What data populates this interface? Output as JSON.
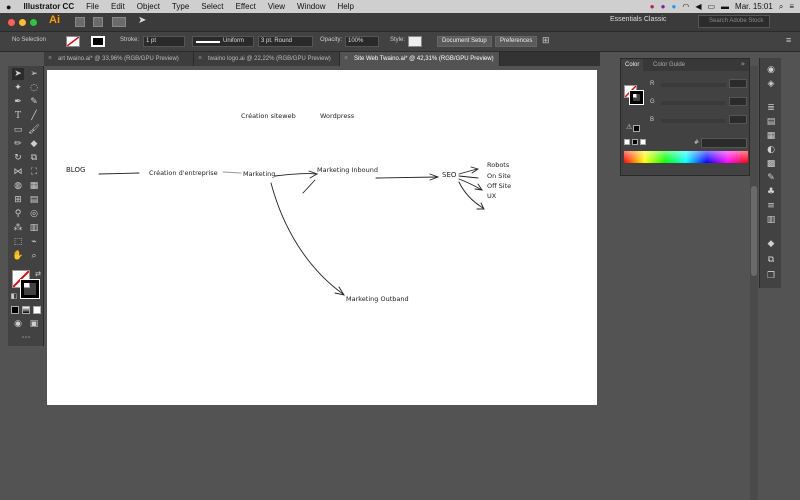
{
  "menubar": {
    "apple": "",
    "app": "Illustrator CC",
    "items": [
      "File",
      "Edit",
      "Object",
      "Type",
      "Select",
      "Effect",
      "View",
      "Window",
      "Help"
    ],
    "clock": "Mar. 15:01"
  },
  "titlebar": {
    "logo": "Ai",
    "workspace": "Essentials Classic",
    "search_placeholder": "Search Adobe Stock"
  },
  "controlbar": {
    "selection": "No Selection",
    "stroke_label": "Stroke:",
    "stroke_value": "1 pt",
    "stroke_style": "Uniform",
    "brush": "3 pt. Round",
    "opacity_label": "Opacity:",
    "opacity_value": "100%",
    "style_label": "Style:",
    "doc_setup": "Document Setup",
    "preferences": "Preferences"
  },
  "tabs": [
    {
      "label": "art twaino.ai* @ 33,96% (RGB/GPU Preview)",
      "active": false
    },
    {
      "label": "twaino logo.ai @ 22,22% (RGB/GPU Preview)",
      "active": false
    },
    {
      "label": "Site Web Twaino.ai* @ 42,31% (RGB/GPU Preview)",
      "active": true
    }
  ],
  "color_panel": {
    "tab_color": "Color",
    "tab_guide": "Color Guide",
    "r": "R",
    "g": "G",
    "b": "B",
    "hex_symbol": "#"
  },
  "artboard": {
    "nodes": {
      "creation_siteweb": "Création siteweb",
      "wordpress": "Wordpress",
      "blog": "BLOG",
      "creation_entreprise": "Création d'entreprise",
      "marketing": "Marketing",
      "marketing_inbound": "Marketing Inbound",
      "seo": "SEO",
      "robots": "Robots",
      "on_site": "On Site",
      "off_site": "Off Site",
      "ux": "UX",
      "marketing_outband": "Marketing Outband"
    }
  },
  "colors": {
    "accent_ai": "#ff9a00",
    "panel": "#424242",
    "canvas_bg": "#535353"
  }
}
